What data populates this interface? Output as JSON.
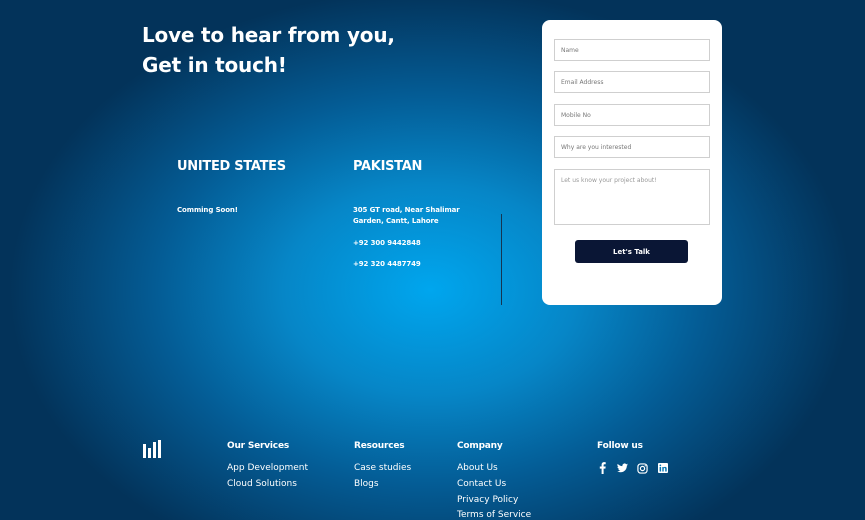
{
  "hero": {
    "line1": "Love to hear from you,",
    "line2": "Get in touch!"
  },
  "offices": {
    "us": {
      "title": "UNITED STATES",
      "text": "Comming Soon!"
    },
    "pk": {
      "title": "PAKISTAN",
      "address_line1": "305 GT road, Near Shalimar",
      "address_line2": "Garden, Cantt, Lahore",
      "phone1": "+92 300 9442848",
      "phone2": "+92 320 4487749"
    }
  },
  "form": {
    "name_placeholder": "Name",
    "email_placeholder": "Email Address",
    "mobile_placeholder": "Mobile No",
    "why_placeholder": "Why are you interested",
    "project_placeholder": "Let us know your project about!",
    "submit_label": "Let's Talk"
  },
  "footer": {
    "logo_alt": "logo-bars-icon",
    "services": {
      "title": "Our Services",
      "items": [
        "App Development",
        "Cloud Solutions"
      ]
    },
    "resources": {
      "title": "Resources",
      "items": [
        "Case studies",
        "Blogs"
      ]
    },
    "company": {
      "title": "Company",
      "items": [
        "About Us",
        "Contact Us",
        "Privacy Policy",
        "Terms of Service"
      ]
    },
    "follow": {
      "title": "Follow us",
      "icons": [
        "facebook-icon",
        "twitter-icon",
        "instagram-icon",
        "linkedin-icon"
      ]
    }
  }
}
